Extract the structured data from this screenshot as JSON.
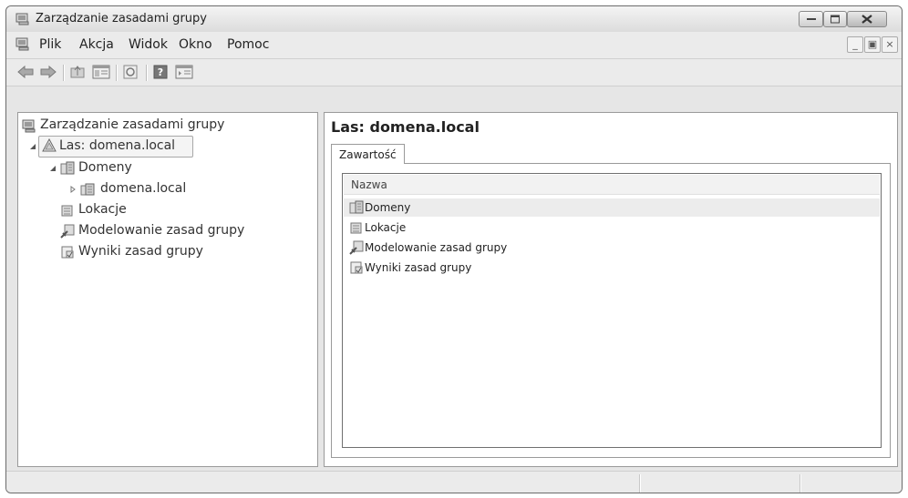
{
  "window": {
    "title": "Zarządzanie zasadami grupy"
  },
  "menu": {
    "items": [
      "Plik",
      "Akcja",
      "Widok",
      "Okno",
      "Pomoc"
    ]
  },
  "toolbar": {
    "icons": [
      "back-icon",
      "forward-icon",
      "up-folder-icon",
      "show-hide-tree-icon",
      "refresh-icon",
      "help-icon",
      "show-action-pane-icon"
    ]
  },
  "tree": {
    "root": "Zarządzanie zasadami grupy",
    "forest": "Las: domena.local",
    "domains": "Domeny",
    "domain_item": "domena.local",
    "sites": "Lokacje",
    "modeling": "Modelowanie zasad grupy",
    "results": "Wyniki zasad grupy"
  },
  "details": {
    "title": "Las: domena.local",
    "tab": "Zawartość",
    "column_name": "Nazwa",
    "rows": [
      "Domeny",
      "Lokacje",
      "Modelowanie zasad grupy",
      "Wyniki zasad grupy"
    ]
  },
  "colors": {
    "window_bg": "#e6e6e6",
    "pane_bg": "#ffffff",
    "highlight_row": "#ececec",
    "close_button": "#c8c8c8"
  }
}
